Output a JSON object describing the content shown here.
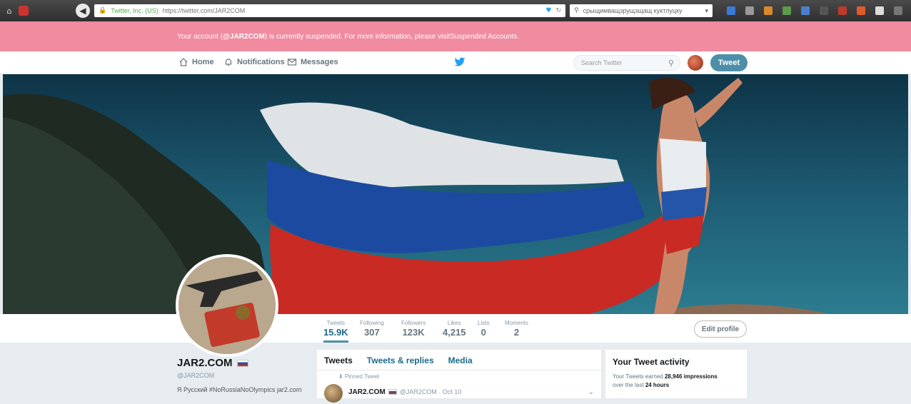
{
  "browser": {
    "site_identity": "Twitter, Inc. (US)",
    "url": "https://twitter.com/JAR2COM",
    "search_query": "срыщимващзрущзщащ куктлуцку"
  },
  "banner": {
    "pre": "Your account (",
    "handle": "@JAR2COM",
    "mid": ") is currently suspended. For more information, please visit ",
    "link": "Suspended Accounts",
    "post": "."
  },
  "nav": {
    "home": "Home",
    "notifications": "Notifications",
    "messages": "Messages",
    "search_placeholder": "Search Twitter",
    "tweet_button": "Tweet"
  },
  "stats": [
    {
      "label": "Tweets",
      "value": "15.9K"
    },
    {
      "label": "Following",
      "value": "307"
    },
    {
      "label": "Followers",
      "value": "123K"
    },
    {
      "label": "Likes",
      "value": "4,215"
    },
    {
      "label": "Lists",
      "value": "0"
    },
    {
      "label": "Moments",
      "value": "2"
    }
  ],
  "edit_profile": "Edit profile",
  "profile": {
    "name": "JAR2.COM",
    "handle": "@JAR2COM",
    "bio": "Я Русский #NoRussiaNoOlympics jar2.com"
  },
  "timeline": {
    "tabs": [
      "Tweets",
      "Tweets & replies",
      "Media"
    ],
    "pinned": "Pinned Tweet",
    "tweet_name": "JAR2.COM",
    "tweet_meta": "@JAR2COM · Oct 10"
  },
  "activity": {
    "title": "Your Tweet activity",
    "pre": "Your Tweets earned ",
    "impressions": "28,946 impressions",
    "mid": "over the last ",
    "period": "24 hours"
  },
  "colors": {
    "banner_bg": "#f08ba0",
    "accent": "#4d8fa8",
    "twitter_blue": "#1da1f2"
  }
}
